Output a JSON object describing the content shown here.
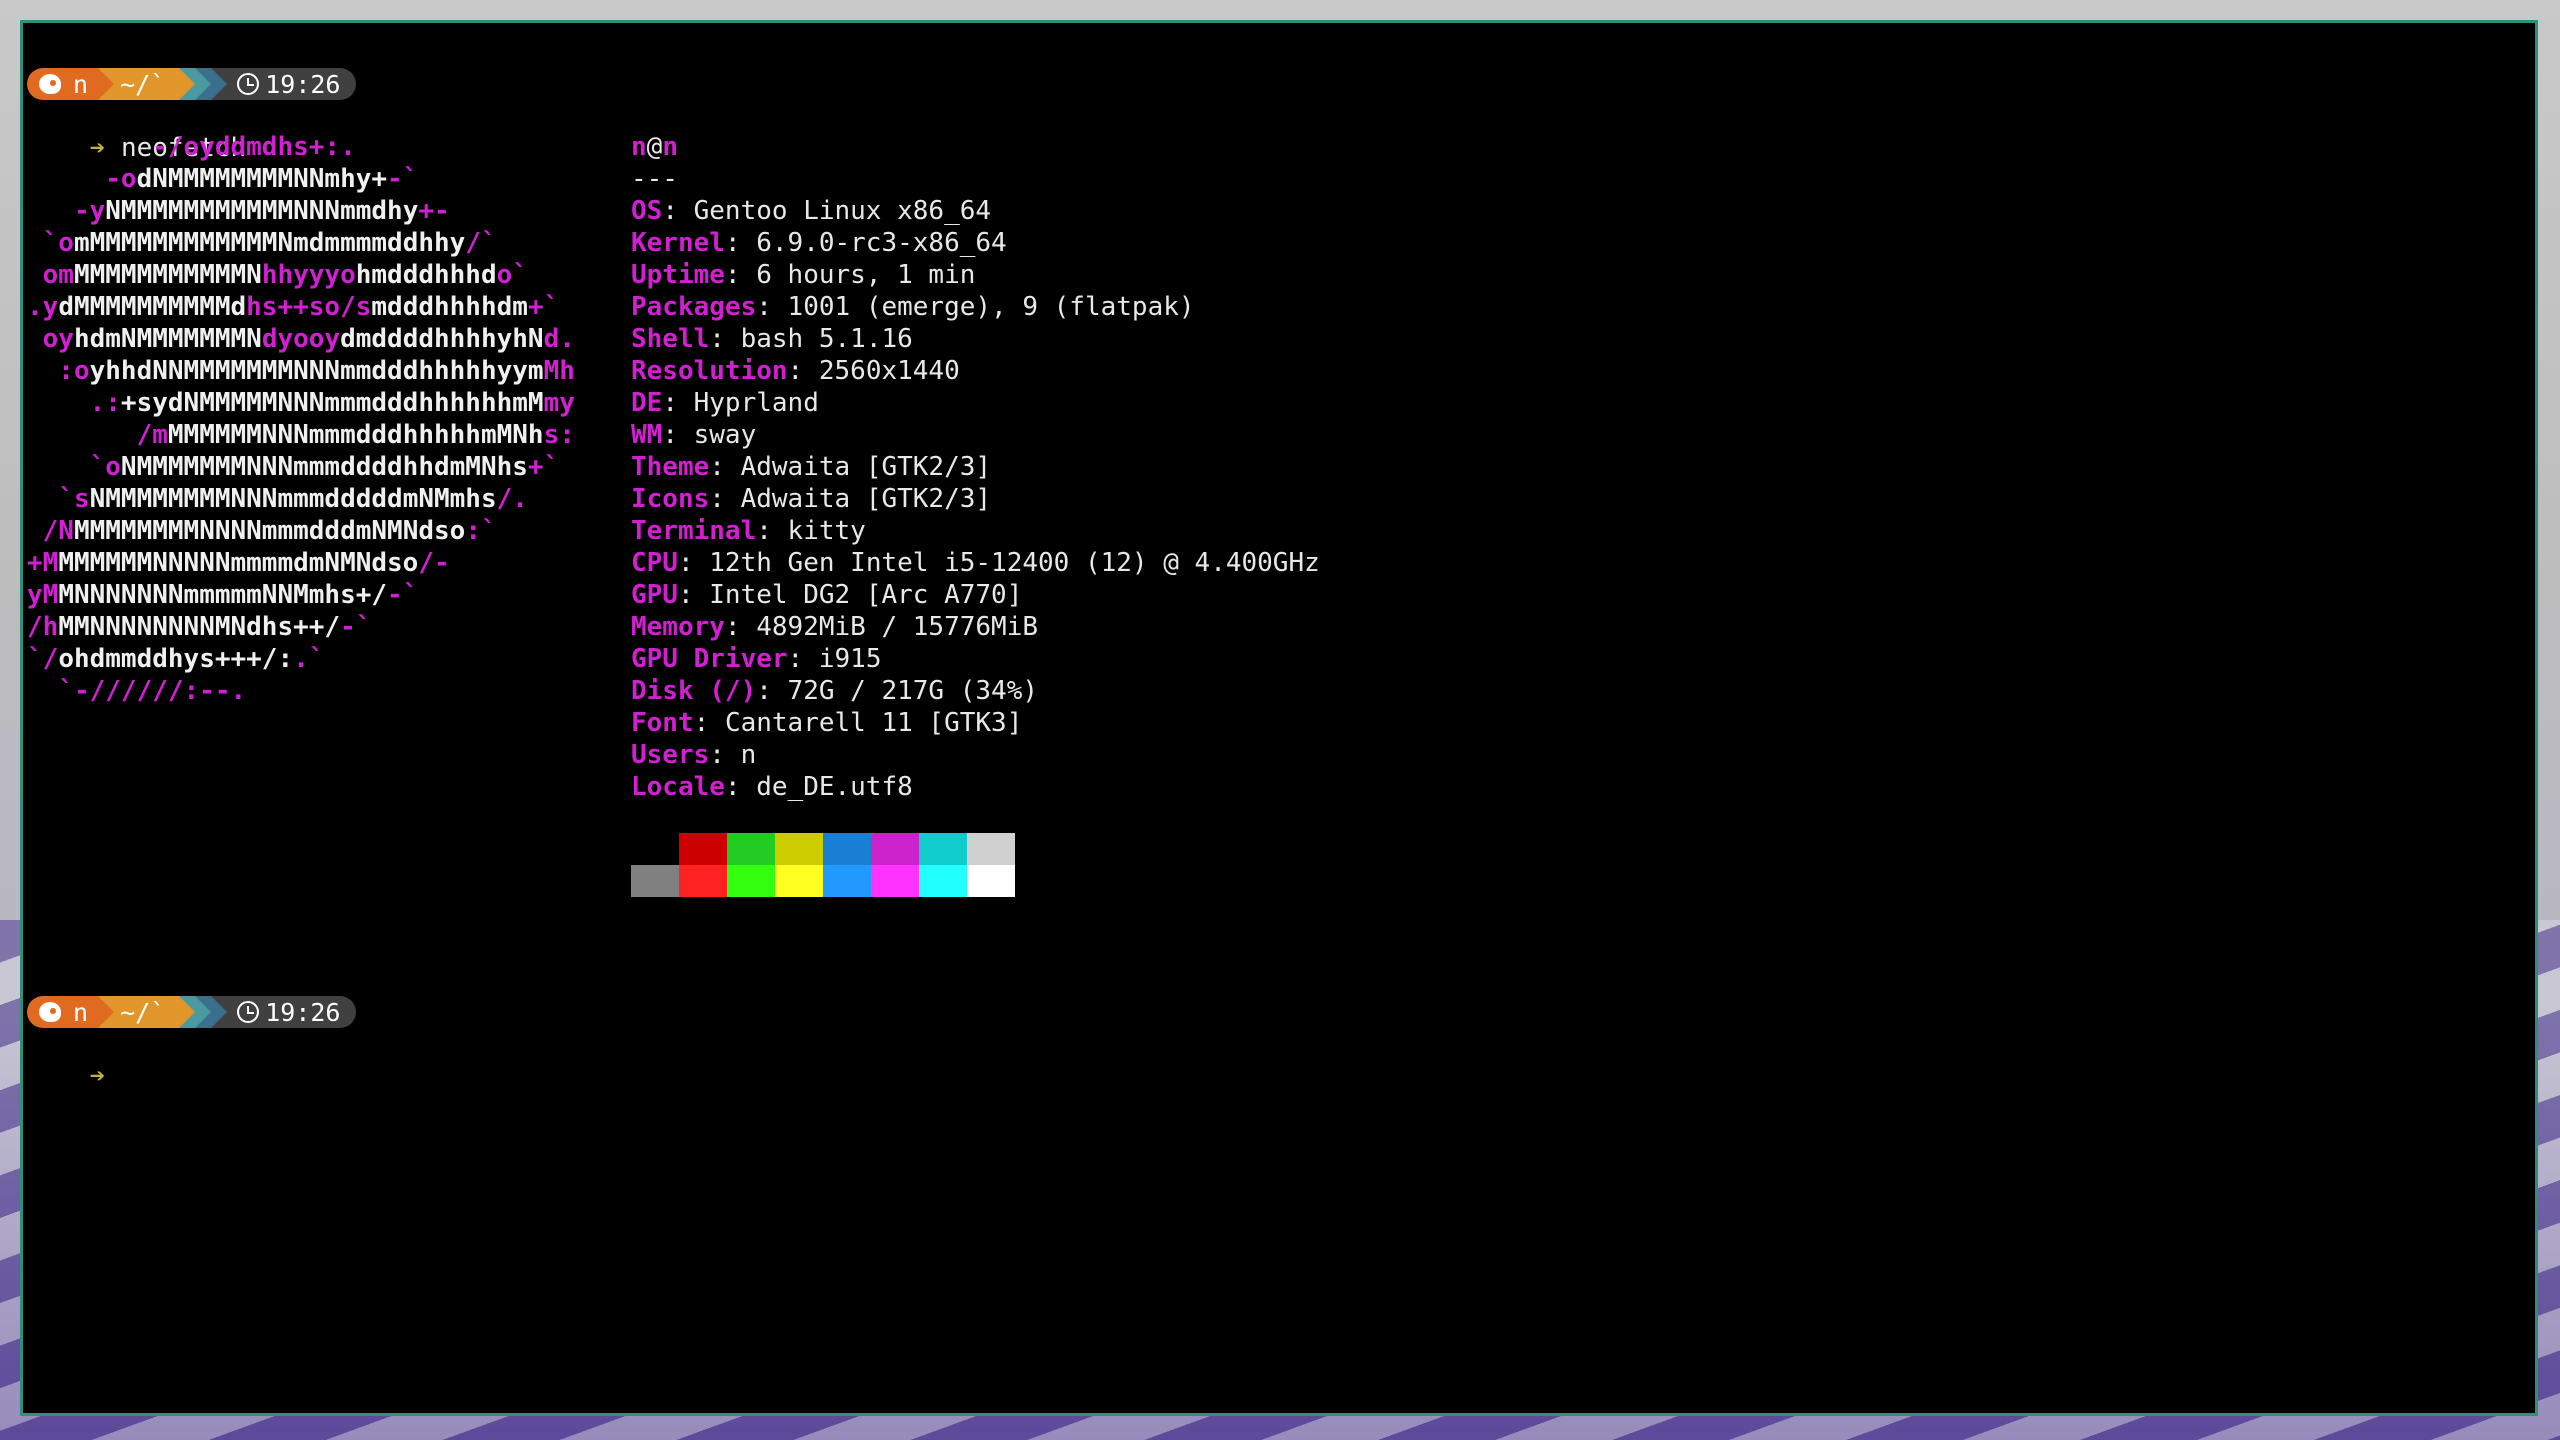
{
  "prompt": {
    "user": "n",
    "path": "~/`",
    "time": "19:26",
    "caret": "➔"
  },
  "command": "neofetch",
  "logo_lines": [
    [
      [
        "        -/oyddmdhs+:.",
        "m"
      ]
    ],
    [
      [
        "     -o",
        "m"
      ],
      [
        "dNMMMMMMMMNNmhy+",
        "w"
      ],
      [
        "-`",
        "m"
      ]
    ],
    [
      [
        "   -y",
        "m"
      ],
      [
        "NMMMMMMMMMMMNNNmmdhy",
        "w"
      ],
      [
        "+-",
        "m"
      ]
    ],
    [
      [
        " `o",
        "m"
      ],
      [
        "mMMMMMMMMMMMMNmdmmmmddhhy",
        "w"
      ],
      [
        "/`",
        "m"
      ]
    ],
    [
      [
        " om",
        "m"
      ],
      [
        "MMMMMMMMMMMN",
        "w"
      ],
      [
        "hhyyyo",
        "m"
      ],
      [
        "hmdddhhhd",
        "w"
      ],
      [
        "o`",
        "m"
      ]
    ],
    [
      [
        ".y",
        "m"
      ],
      [
        "dMMMMMMMMMMd",
        "w"
      ],
      [
        "hs++so/s",
        "m"
      ],
      [
        "mdddhhhhdm",
        "w"
      ],
      [
        "+`",
        "m"
      ]
    ],
    [
      [
        " oy",
        "m"
      ],
      [
        "hdmNMMMMMMMN",
        "w"
      ],
      [
        "dyooy",
        "m"
      ],
      [
        "dmddddhhhhyhN",
        "w"
      ],
      [
        "d.",
        "m"
      ]
    ],
    [
      [
        "  :o",
        "m"
      ],
      [
        "yhhdNNMMMMMMMNNNmmdddhhhhhyym",
        "w"
      ],
      [
        "Mh",
        "m"
      ]
    ],
    [
      [
        "    .:",
        "m"
      ],
      [
        "+sydNMMMMMNNNmmmdddhhhhhhmM",
        "w"
      ],
      [
        "my",
        "m"
      ]
    ],
    [
      [
        "       /m",
        "m"
      ],
      [
        "MMMMMMNNNmmmdddhhhhhmMNh",
        "w"
      ],
      [
        "s:",
        "m"
      ]
    ],
    [
      [
        "    `o",
        "m"
      ],
      [
        "NMMMMMMMNNNmmmddddhhdmMNhs",
        "w"
      ],
      [
        "+`",
        "m"
      ]
    ],
    [
      [
        "  `s",
        "m"
      ],
      [
        "NMMMMMMMMNNNmmmdddddmNMmhs",
        "w"
      ],
      [
        "/.",
        "m"
      ]
    ],
    [
      [
        " /N",
        "m"
      ],
      [
        "MMMMMMMMNNNNmmmdddmNMNdso",
        "w"
      ],
      [
        ":`",
        "m"
      ]
    ],
    [
      [
        "+M",
        "m"
      ],
      [
        "MMMMMMNNNNNmmmmdmNMNdso",
        "w"
      ],
      [
        "/-",
        "m"
      ]
    ],
    [
      [
        "yM",
        "m"
      ],
      [
        "MNNNNNNNmmmmmNNMmhs+/",
        "w"
      ],
      [
        "-`",
        "m"
      ]
    ],
    [
      [
        "/h",
        "m"
      ],
      [
        "MMNNNNNNNNMNdhs++/",
        "w"
      ],
      [
        "-`",
        "m"
      ]
    ],
    [
      [
        "`/",
        "m"
      ],
      [
        "ohdmmddhys+++/:",
        "w"
      ],
      [
        ".`",
        "m"
      ]
    ],
    [
      [
        "  `-//////:--.",
        "m"
      ]
    ]
  ],
  "info": {
    "title_user": "n",
    "title_at": "@",
    "title_host": "n",
    "separator": "---",
    "rows": [
      {
        "key": "OS",
        "value": "Gentoo Linux x86_64"
      },
      {
        "key": "Kernel",
        "value": "6.9.0-rc3-x86_64"
      },
      {
        "key": "Uptime",
        "value": "6 hours, 1 min"
      },
      {
        "key": "Packages",
        "value": "1001 (emerge), 9 (flatpak)"
      },
      {
        "key": "Shell",
        "value": "bash 5.1.16"
      },
      {
        "key": "Resolution",
        "value": "2560x1440"
      },
      {
        "key": "DE",
        "value": "Hyprland"
      },
      {
        "key": "WM",
        "value": "sway"
      },
      {
        "key": "Theme",
        "value": "Adwaita [GTK2/3]"
      },
      {
        "key": "Icons",
        "value": "Adwaita [GTK2/3]"
      },
      {
        "key": "Terminal",
        "value": "kitty"
      },
      {
        "key": "CPU",
        "value": "12th Gen Intel i5-12400 (12) @ 4.400GHz"
      },
      {
        "key": "GPU",
        "value": "Intel DG2 [Arc A770]"
      },
      {
        "key": "Memory",
        "value": "4892MiB / 15776MiB"
      },
      {
        "key": "GPU Driver",
        "value": "i915"
      },
      {
        "key": "Disk (/)",
        "value": "72G / 217G (34%)"
      },
      {
        "key": "Font",
        "value": "Cantarell 11 [GTK3]"
      },
      {
        "key": "Users",
        "value": "n"
      },
      {
        "key": "Locale",
        "value": "de_DE.utf8"
      }
    ]
  },
  "palette": {
    "row1": [
      "#000000",
      "#cc0000",
      "#22cc22",
      "#cccc00",
      "#1a7fd4",
      "#cc22cc",
      "#11cccc",
      "#d0d0d0"
    ],
    "row2": [
      "#808080",
      "#ff2222",
      "#33ff11",
      "#ffff22",
      "#2299ff",
      "#ff33ff",
      "#22ffff",
      "#ffffff"
    ]
  }
}
